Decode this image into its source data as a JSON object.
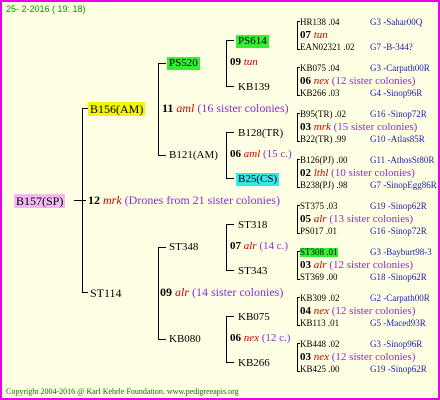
{
  "header": {
    "date": "25-  2-2016 ( 19: 18)"
  },
  "footer": {
    "copyright": "Copyright 2004-2016 @ Karl Kehrle Foundation.   www.pedigreeapis.org"
  },
  "root": {
    "id": "B157(SP)",
    "num": "12",
    "race": "mrk",
    "note": "(Drones from 21 sister colonies)",
    "color": "#f5b8f5"
  },
  "gen1": [
    {
      "id": "B156(AM)",
      "num": "11",
      "race": "aml",
      "note": "(16 sister colonies)",
      "color": "#f5f500"
    },
    {
      "id": "ST114",
      "num": "09",
      "race": "alr",
      "note": "(14 sister colonies)"
    }
  ],
  "gen2": [
    {
      "id": "PS520",
      "num": "09",
      "race": "tun",
      "note": "",
      "color": "#33ee33"
    },
    {
      "id": "B121(AM)",
      "num": "06",
      "race": "aml",
      "note": "(15 c.)"
    },
    {
      "id": "ST348",
      "num": "07",
      "race": "alr",
      "note": "(14 c.)"
    },
    {
      "id": "KB080",
      "num": "06",
      "race": "nex",
      "note": "(12 c.)"
    }
  ],
  "gen3": [
    {
      "id": "PS614",
      "color": "#33ee33"
    },
    {
      "id": "KB139"
    },
    {
      "id": "B128(TR)"
    },
    {
      "id": "B25(CS)",
      "color": "#33e8e8"
    },
    {
      "id": "ST318"
    },
    {
      "id": "ST343"
    },
    {
      "id": "KB075"
    },
    {
      "id": "KB266"
    }
  ],
  "gen4": [
    {
      "top": "HR138 .04",
      "topr": "G3 -Sahar00Q",
      "num": "07",
      "race": "tun",
      "note": "",
      "bot": "EAN02321 .02",
      "botr": "G7 -B-344?"
    },
    {
      "top": "KB075 .04",
      "topr": "G3 -Carpath00R",
      "num": "06",
      "race": "nex",
      "note": "(12 sister colonies)",
      "bot": "KB266 .03",
      "botr": "G4 -Sinop96R"
    },
    {
      "top": "B95(TR) .02",
      "topr": "G16 -Sinop72R",
      "num": "03",
      "race": "mrk",
      "note": "(15 sister colonies)",
      "bot": "B22(TR) .99",
      "botr": "G10 -Atlas85R"
    },
    {
      "top": "B126(PJ) .00",
      "topr": "G11 -AthosSt80R",
      "num": "02",
      "race": "lthl",
      "note": "(10 sister colonies)",
      "bot": "B238(PJ) .98",
      "botr": "G7 -SinopEgg86R"
    },
    {
      "top": "ST375 .03",
      "topr": "G19 -Sinop62R",
      "num": "05",
      "race": "alr",
      "note": "(13 sister colonies)",
      "bot": "PS017 .01",
      "botr": "G16 -Sinop72R"
    },
    {
      "top": "ST308 .01",
      "topr": "G3 -Bayburt98-3",
      "topc": "#33ee33",
      "num": "03",
      "race": "alr",
      "note": "(12 sister colonies)",
      "bot": "ST369 .00",
      "botr": "G18 -Sinop62R"
    },
    {
      "top": "KB309 .02",
      "topr": "G2 -Carpath00R",
      "num": "04",
      "race": "nex",
      "note": "(12 sister colonies)",
      "bot": "KB113 .01",
      "botr": "G5 -Maced93R"
    },
    {
      "top": "KB448 .02",
      "topr": "G3 -Sinop96R",
      "num": "03",
      "race": "nex",
      "note": "(12 sister colonies)",
      "bot": "KB425 .00",
      "botr": "G19 -Sinop62R"
    }
  ]
}
